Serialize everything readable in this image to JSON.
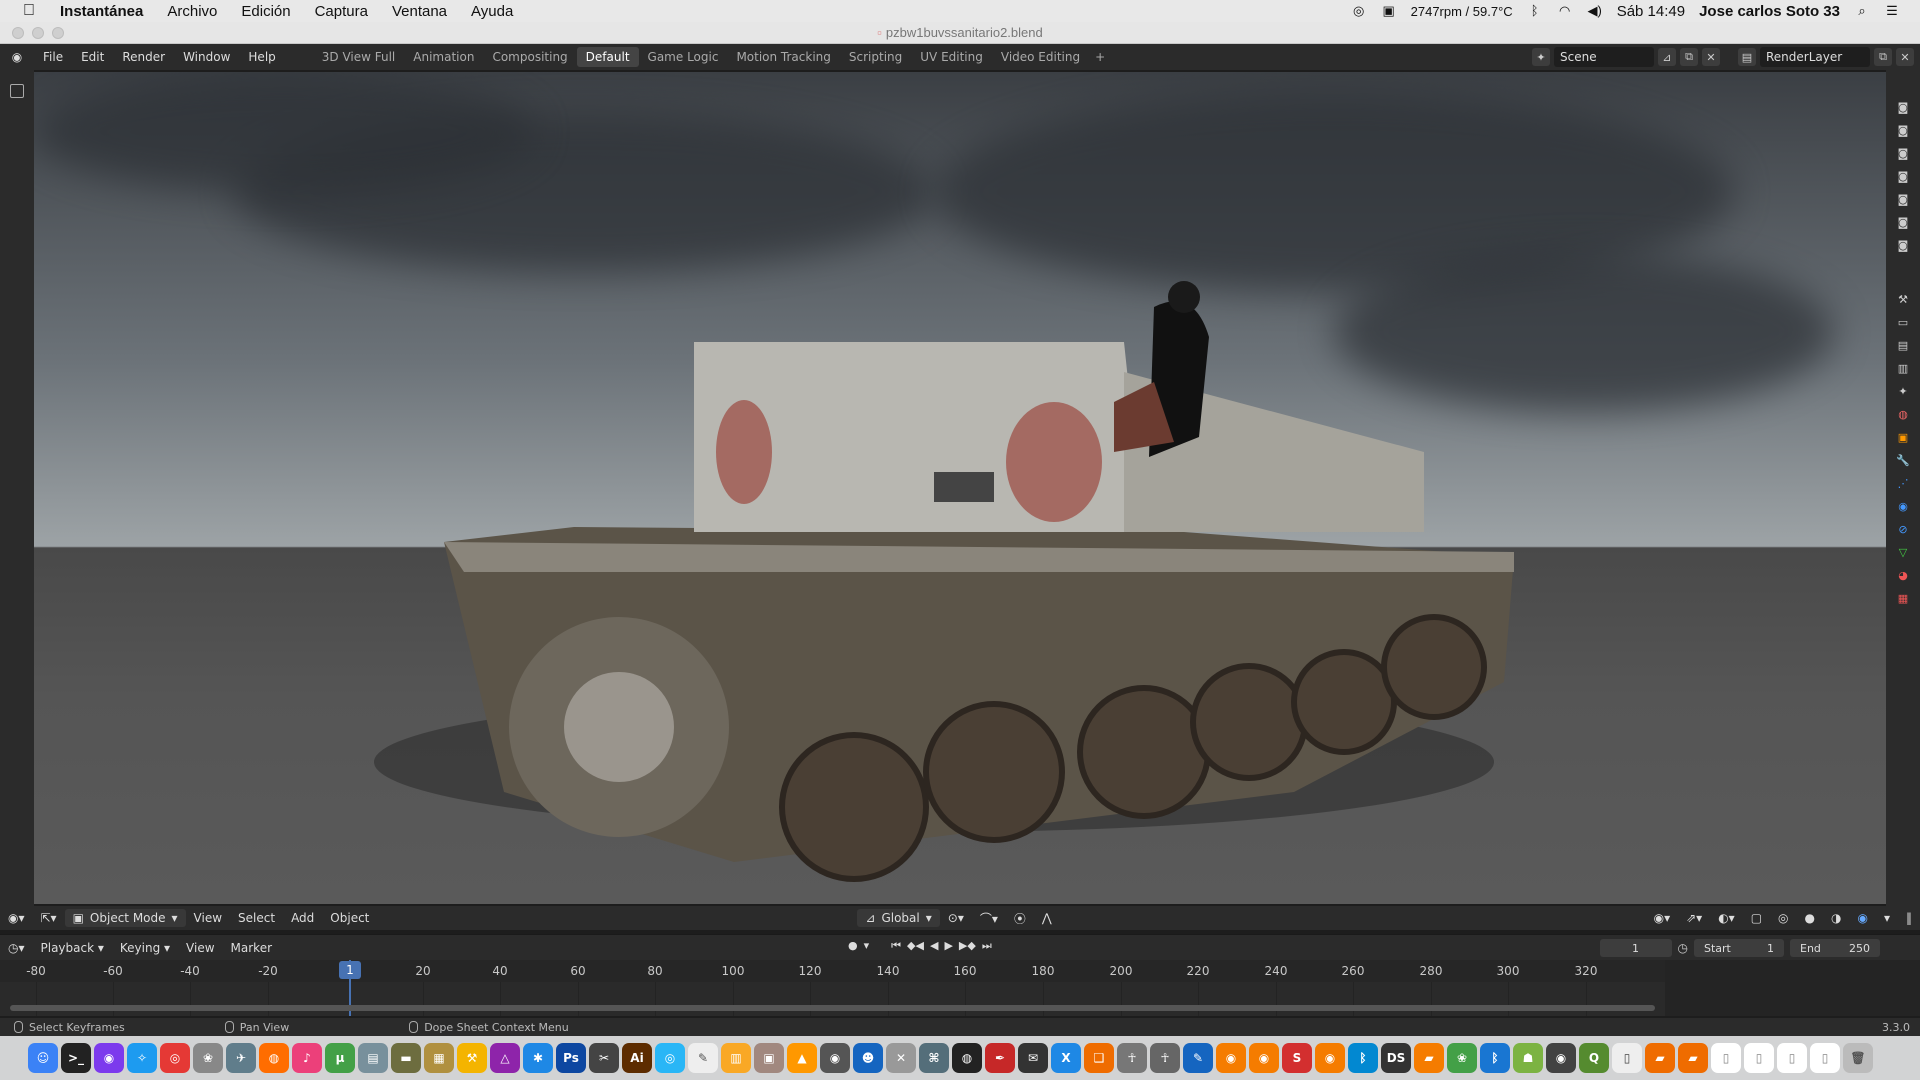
{
  "macos_menubar": {
    "apple_icon": "apple-icon",
    "app_name": "Instantánea",
    "menus": [
      "Archivo",
      "Edición",
      "Captura",
      "Ventana",
      "Ayuda"
    ],
    "status": {
      "fan": "2747rpm / 59.7°C",
      "datetime": "Sáb 14:49",
      "user": "Jose carlos Soto 33"
    }
  },
  "window": {
    "title": "pzbw1buvssanitario2.blend"
  },
  "blender_topbar": {
    "menus": [
      "File",
      "Edit",
      "Render",
      "Window",
      "Help"
    ],
    "workspaces": [
      "3D View Full",
      "Animation",
      "Compositing",
      "Default",
      "Game Logic",
      "Motion Tracking",
      "Scripting",
      "UV Editing",
      "Video Editing"
    ],
    "active_workspace": "Default",
    "scene": "Scene",
    "view_layer": "RenderLayer"
  },
  "viewport_header": {
    "mode": "Object Mode",
    "menus": [
      "View",
      "Select",
      "Add",
      "Object"
    ],
    "orientation": "Global"
  },
  "timeline_header": {
    "menus": [
      "Playback",
      "Keying",
      "View",
      "Marker"
    ],
    "current_frame": "1",
    "start_label": "Start",
    "start_value": "1",
    "end_label": "End",
    "end_value": "250"
  },
  "timeline": {
    "ticks": [
      "-80",
      "-60",
      "-40",
      "-20",
      "20",
      "40",
      "60",
      "80",
      "100",
      "120",
      "140",
      "160",
      "180",
      "200",
      "220",
      "240",
      "260",
      "280",
      "300",
      "320"
    ],
    "current_frame": "1"
  },
  "statusbar": {
    "items": [
      "Select Keyframes",
      "Pan View",
      "Dope Sheet Context Menu"
    ],
    "version": "3.3.0"
  },
  "dock": {
    "apps": [
      "finder",
      "terminal",
      "siri",
      "safari",
      "chrome",
      "photos",
      "launchpad",
      "firefox",
      "itunes",
      "utorrent",
      "preview",
      "screenshot",
      "blender-app",
      "xcode",
      "affinity",
      "settings",
      "photoshop",
      "capture",
      "illustrator",
      "browser",
      "textedit",
      "files",
      "folder",
      "vlc",
      "diskutility",
      "finder2",
      "airport",
      "crosscheck",
      "globe",
      "quill",
      "mail",
      "x-app",
      "books",
      "daz",
      "poser",
      "blender",
      "blender2",
      "sublime",
      "blender3",
      "bluetooth",
      "ds",
      "pages",
      "photos2",
      "bluetooth2",
      "android",
      "gpu",
      "qgis",
      "mirror",
      "files2",
      "files3",
      "doc1",
      "doc2",
      "doc3",
      "doc4",
      "trash"
    ]
  }
}
